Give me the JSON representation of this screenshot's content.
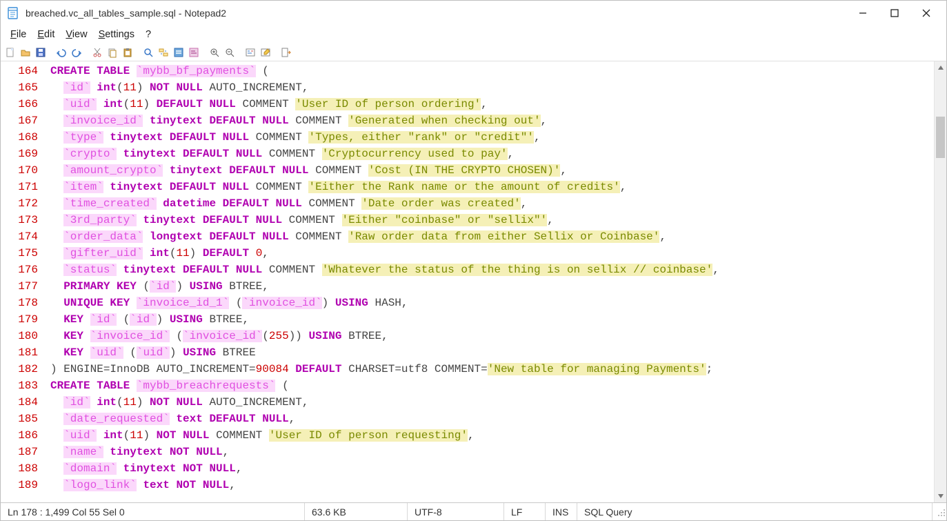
{
  "title": "breached.vc_all_tables_sample.sql - Notepad2",
  "menu": {
    "file": "File",
    "edit": "Edit",
    "view": "View",
    "settings": "Settings",
    "help": "?"
  },
  "status": {
    "pos": "Ln 178 : 1,499   Col 55   Sel 0",
    "size": "63.6 KB",
    "enc": "UTF-8",
    "eol": "LF",
    "ovr": "INS",
    "lexer": "SQL Query"
  },
  "first_line": 164,
  "tokens": [
    [
      [
        "kw",
        "CREATE TABLE "
      ],
      [
        "id",
        "`mybb_bf_payments`"
      ],
      [
        "pl",
        " ("
      ]
    ],
    [
      [
        "pl",
        "  "
      ],
      [
        "id",
        "`id`"
      ],
      [
        "pl",
        " "
      ],
      [
        "kw",
        "int"
      ],
      [
        "pl",
        "("
      ],
      [
        "num",
        "11"
      ],
      [
        "pl",
        ") "
      ],
      [
        "kw",
        "NOT NULL"
      ],
      [
        "pl",
        " AUTO_INCREMENT,"
      ]
    ],
    [
      [
        "pl",
        "  "
      ],
      [
        "id",
        "`uid`"
      ],
      [
        "pl",
        " "
      ],
      [
        "kw",
        "int"
      ],
      [
        "pl",
        "("
      ],
      [
        "num",
        "11"
      ],
      [
        "pl",
        ") "
      ],
      [
        "kw",
        "DEFAULT NULL"
      ],
      [
        "pl",
        " COMMENT "
      ],
      [
        "str",
        "'User ID of person ordering'"
      ],
      [
        "pl",
        ","
      ]
    ],
    [
      [
        "pl",
        "  "
      ],
      [
        "id",
        "`invoice_id`"
      ],
      [
        "pl",
        " "
      ],
      [
        "kw",
        "tinytext DEFAULT NULL"
      ],
      [
        "pl",
        " COMMENT "
      ],
      [
        "str",
        "'Generated when checking out'"
      ],
      [
        "pl",
        ","
      ]
    ],
    [
      [
        "pl",
        "  "
      ],
      [
        "id",
        "`type`"
      ],
      [
        "pl",
        " "
      ],
      [
        "kw",
        "tinytext DEFAULT NULL"
      ],
      [
        "pl",
        " COMMENT "
      ],
      [
        "str",
        "'Types, either \"rank\" or \"credit\"'"
      ],
      [
        "pl",
        ","
      ]
    ],
    [
      [
        "pl",
        "  "
      ],
      [
        "id",
        "`crypto`"
      ],
      [
        "pl",
        " "
      ],
      [
        "kw",
        "tinytext DEFAULT NULL"
      ],
      [
        "pl",
        " COMMENT "
      ],
      [
        "str",
        "'Cryptocurrency used to pay'"
      ],
      [
        "pl",
        ","
      ]
    ],
    [
      [
        "pl",
        "  "
      ],
      [
        "id",
        "`amount_crypto`"
      ],
      [
        "pl",
        " "
      ],
      [
        "kw",
        "tinytext DEFAULT NULL"
      ],
      [
        "pl",
        " COMMENT "
      ],
      [
        "str",
        "'Cost (IN THE CRYPTO CHOSEN)'"
      ],
      [
        "pl",
        ","
      ]
    ],
    [
      [
        "pl",
        "  "
      ],
      [
        "id",
        "`item`"
      ],
      [
        "pl",
        " "
      ],
      [
        "kw",
        "tinytext DEFAULT NULL"
      ],
      [
        "pl",
        " COMMENT "
      ],
      [
        "str",
        "'Either the Rank name or the amount of credits'"
      ],
      [
        "pl",
        ","
      ]
    ],
    [
      [
        "pl",
        "  "
      ],
      [
        "id",
        "`time_created`"
      ],
      [
        "pl",
        " "
      ],
      [
        "kw",
        "datetime DEFAULT NULL"
      ],
      [
        "pl",
        " COMMENT "
      ],
      [
        "str",
        "'Date order was created'"
      ],
      [
        "pl",
        ","
      ]
    ],
    [
      [
        "pl",
        "  "
      ],
      [
        "id",
        "`3rd_party`"
      ],
      [
        "pl",
        " "
      ],
      [
        "kw",
        "tinytext DEFAULT NULL"
      ],
      [
        "pl",
        " COMMENT "
      ],
      [
        "str",
        "'Either \"coinbase\" or \"sellix\"'"
      ],
      [
        "pl",
        ","
      ]
    ],
    [
      [
        "pl",
        "  "
      ],
      [
        "id",
        "`order_data`"
      ],
      [
        "pl",
        " "
      ],
      [
        "kw",
        "longtext DEFAULT NULL"
      ],
      [
        "pl",
        " COMMENT "
      ],
      [
        "str",
        "'Raw order data from either Sellix or Coinbase'"
      ],
      [
        "pl",
        ","
      ]
    ],
    [
      [
        "pl",
        "  "
      ],
      [
        "id",
        "`gifter_uid`"
      ],
      [
        "pl",
        " "
      ],
      [
        "kw",
        "int"
      ],
      [
        "pl",
        "("
      ],
      [
        "num",
        "11"
      ],
      [
        "pl",
        ") "
      ],
      [
        "kw",
        "DEFAULT"
      ],
      [
        "pl",
        " "
      ],
      [
        "num",
        "0"
      ],
      [
        "pl",
        ","
      ]
    ],
    [
      [
        "pl",
        "  "
      ],
      [
        "id",
        "`status`"
      ],
      [
        "pl",
        " "
      ],
      [
        "kw",
        "tinytext DEFAULT NULL"
      ],
      [
        "pl",
        " COMMENT "
      ],
      [
        "str",
        "'Whatever the status of the thing is on sellix // coinbase'"
      ],
      [
        "pl",
        ","
      ]
    ],
    [
      [
        "pl",
        "  "
      ],
      [
        "kw",
        "PRIMARY KEY"
      ],
      [
        "pl",
        " ("
      ],
      [
        "id",
        "`id`"
      ],
      [
        "pl",
        ") "
      ],
      [
        "kw",
        "USING"
      ],
      [
        "pl",
        " BTREE,"
      ]
    ],
    [
      [
        "pl",
        "  "
      ],
      [
        "kw",
        "UNIQUE KEY"
      ],
      [
        "pl",
        " "
      ],
      [
        "id",
        "`invoice_id_1`"
      ],
      [
        "pl",
        " ("
      ],
      [
        "id",
        "`invoice_id`"
      ],
      [
        "pl",
        ") "
      ],
      [
        "kw",
        "USING"
      ],
      [
        "pl",
        " HASH,"
      ]
    ],
    [
      [
        "pl",
        "  "
      ],
      [
        "kw",
        "KEY"
      ],
      [
        "pl",
        " "
      ],
      [
        "id",
        "`id`"
      ],
      [
        "pl",
        " ("
      ],
      [
        "id",
        "`id`"
      ],
      [
        "pl",
        ") "
      ],
      [
        "kw",
        "USING"
      ],
      [
        "pl",
        " BTREE,"
      ]
    ],
    [
      [
        "pl",
        "  "
      ],
      [
        "kw",
        "KEY"
      ],
      [
        "pl",
        " "
      ],
      [
        "id",
        "`invoice_id`"
      ],
      [
        "pl",
        " ("
      ],
      [
        "id",
        "`invoice_id`"
      ],
      [
        "pl",
        "("
      ],
      [
        "num",
        "255"
      ],
      [
        "pl",
        ")) "
      ],
      [
        "kw",
        "USING"
      ],
      [
        "pl",
        " BTREE,"
      ]
    ],
    [
      [
        "pl",
        "  "
      ],
      [
        "kw",
        "KEY"
      ],
      [
        "pl",
        " "
      ],
      [
        "id",
        "`uid`"
      ],
      [
        "pl",
        " ("
      ],
      [
        "id",
        "`uid`"
      ],
      [
        "pl",
        ") "
      ],
      [
        "kw",
        "USING"
      ],
      [
        "pl",
        " BTREE"
      ]
    ],
    [
      [
        "pl",
        ") ENGINE=InnoDB AUTO_INCREMENT="
      ],
      [
        "num",
        "90084"
      ],
      [
        "pl",
        " "
      ],
      [
        "kw",
        "DEFAULT"
      ],
      [
        "pl",
        " CHARSET=utf8 COMMENT="
      ],
      [
        "str",
        "'New table for managing Payments'"
      ],
      [
        "pl",
        ";"
      ]
    ],
    [
      [
        "kw",
        "CREATE TABLE "
      ],
      [
        "id",
        "`mybb_breachrequests`"
      ],
      [
        "pl",
        " ("
      ]
    ],
    [
      [
        "pl",
        "  "
      ],
      [
        "id",
        "`id`"
      ],
      [
        "pl",
        " "
      ],
      [
        "kw",
        "int"
      ],
      [
        "pl",
        "("
      ],
      [
        "num",
        "11"
      ],
      [
        "pl",
        ") "
      ],
      [
        "kw",
        "NOT NULL"
      ],
      [
        "pl",
        " AUTO_INCREMENT,"
      ]
    ],
    [
      [
        "pl",
        "  "
      ],
      [
        "id",
        "`date_requested`"
      ],
      [
        "pl",
        " "
      ],
      [
        "kw",
        "text DEFAULT NULL"
      ],
      [
        "pl",
        ","
      ]
    ],
    [
      [
        "pl",
        "  "
      ],
      [
        "id",
        "`uid`"
      ],
      [
        "pl",
        " "
      ],
      [
        "kw",
        "int"
      ],
      [
        "pl",
        "("
      ],
      [
        "num",
        "11"
      ],
      [
        "pl",
        ") "
      ],
      [
        "kw",
        "NOT NULL"
      ],
      [
        "pl",
        " COMMENT "
      ],
      [
        "str",
        "'User ID of person requesting'"
      ],
      [
        "pl",
        ","
      ]
    ],
    [
      [
        "pl",
        "  "
      ],
      [
        "id",
        "`name`"
      ],
      [
        "pl",
        " "
      ],
      [
        "kw",
        "tinytext NOT NULL"
      ],
      [
        "pl",
        ","
      ]
    ],
    [
      [
        "pl",
        "  "
      ],
      [
        "id",
        "`domain`"
      ],
      [
        "pl",
        " "
      ],
      [
        "kw",
        "tinytext NOT NULL"
      ],
      [
        "pl",
        ","
      ]
    ],
    [
      [
        "pl",
        "  "
      ],
      [
        "id",
        "`logo_link`"
      ],
      [
        "pl",
        " "
      ],
      [
        "kw",
        "text NOT NULL"
      ],
      [
        "pl",
        ","
      ]
    ]
  ],
  "caret_row_index": 14
}
